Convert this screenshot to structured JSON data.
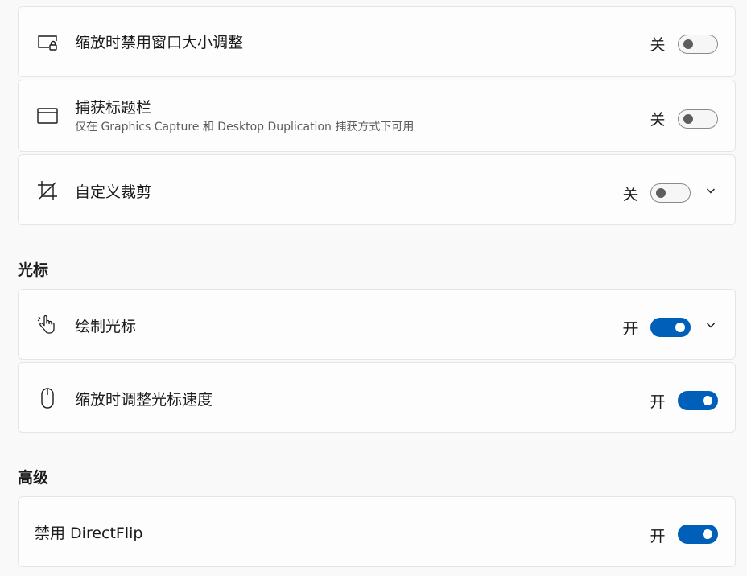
{
  "settings": {
    "disable_resize": {
      "title": "缩放时禁用窗口大小调整",
      "state": "关",
      "on": false,
      "icon": "window-lock-icon"
    },
    "capture_titlebar": {
      "title": "捕获标题栏",
      "subtitle": "仅在 Graphics Capture 和 Desktop Duplication 捕获方式下可用",
      "state": "关",
      "on": false,
      "icon": "window-titlebar-icon"
    },
    "custom_crop": {
      "title": "自定义裁剪",
      "state": "关",
      "on": false,
      "icon": "crop-icon",
      "expandable": true
    }
  },
  "cursor_section": {
    "heading": "光标",
    "draw_cursor": {
      "title": "绘制光标",
      "state": "开",
      "on": true,
      "icon": "hand-pointer-icon",
      "expandable": true
    },
    "adjust_speed": {
      "title": "缩放时调整光标速度",
      "state": "开",
      "on": true,
      "icon": "mouse-icon"
    }
  },
  "advanced_section": {
    "heading": "高级",
    "disable_directflip": {
      "title": "禁用 DirectFlip",
      "state": "开",
      "on": true
    }
  },
  "colors": {
    "accent": "#005fb8",
    "card_bg": "#fdfdfd",
    "page_bg": "#f9f9f9"
  }
}
